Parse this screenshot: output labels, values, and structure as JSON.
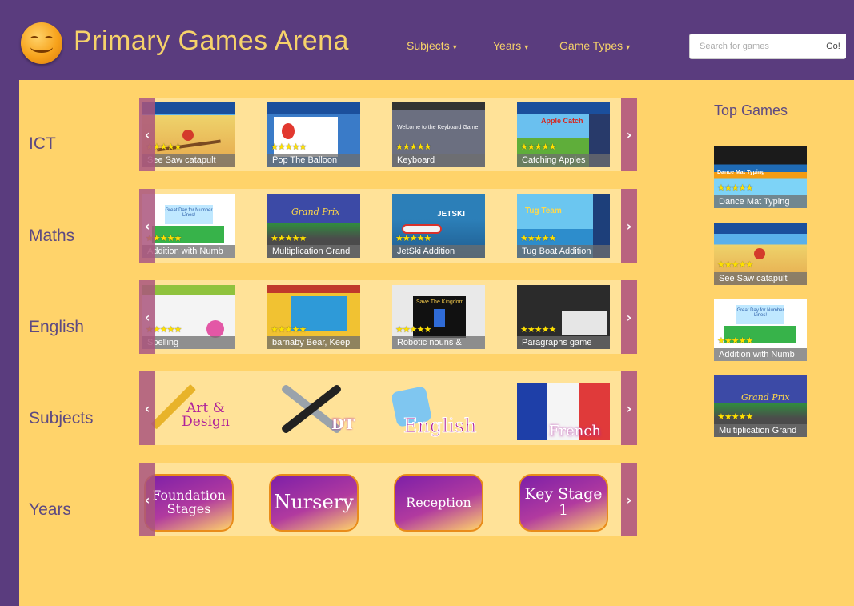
{
  "header": {
    "site_title": "Primary Games Arena",
    "nav": [
      {
        "label": "Subjects"
      },
      {
        "label": "Years"
      },
      {
        "label": "Game Types"
      }
    ],
    "search_placeholder": "Search for games",
    "search_button": "Go!"
  },
  "rows": [
    {
      "label": "ICT",
      "tiles": [
        {
          "caption": "See Saw catapult",
          "stars": "★★★★★"
        },
        {
          "caption": "Pop The Balloon",
          "stars": "★★★★★"
        },
        {
          "caption": "Keyboard",
          "stars": "★★★★★"
        },
        {
          "caption": "Catching Apples",
          "stars": "★★★★★"
        }
      ]
    },
    {
      "label": "Maths",
      "tiles": [
        {
          "caption": "Addition with Numb",
          "stars": "★★★★★"
        },
        {
          "caption": "Multiplication Grand",
          "stars": "★★★★★"
        },
        {
          "caption": "JetSki Addition",
          "stars": "★★★★★"
        },
        {
          "caption": "Tug Boat Addition",
          "stars": "★★★★★"
        }
      ]
    },
    {
      "label": "English",
      "tiles": [
        {
          "caption": "Spelling",
          "stars": "★★★★★"
        },
        {
          "caption": "barnaby Bear, Keep",
          "stars": "★★★★★"
        },
        {
          "caption": "Robotic nouns &",
          "stars": "★★★★★"
        },
        {
          "caption": "Paragraphs game",
          "stars": "★★★★★"
        }
      ]
    },
    {
      "label": "Subjects",
      "tiles": [
        {
          "caption": "Art & Design"
        },
        {
          "caption": "DT"
        },
        {
          "caption": "English"
        },
        {
          "caption": "French"
        }
      ]
    },
    {
      "label": "Years",
      "tiles": [
        {
          "caption": "Foundation Stages"
        },
        {
          "caption": "Nursery"
        },
        {
          "caption": "Reception"
        },
        {
          "caption": "Key Stage 1"
        }
      ]
    }
  ],
  "thumb_text": {
    "keyboard_heading": "Welcome to the Keyboard Game!",
    "numberline_heading": "Great Day for Number Lines!",
    "grand_prix": "Grand Prix",
    "jetski": "JETSKI",
    "tug_team": "Tug Team",
    "save_kingdom": "Save The Kingdom",
    "apple_catch": "Apple Catch",
    "dance_mat": "Dance Mat Typing"
  },
  "sidebar": {
    "title": "Top Games",
    "items": [
      {
        "caption": "Dance Mat Typing",
        "stars": "★★★★★"
      },
      {
        "caption": "See Saw catapult",
        "stars": "★★★★★"
      },
      {
        "caption": "Addition with Numb",
        "stars": "★★★★★"
      },
      {
        "caption": "Multiplication Grand",
        "stars": "★★★★★"
      }
    ]
  },
  "arrows": {
    "left": "‹",
    "right": "›"
  },
  "colors": {
    "header_bg": "#5a3c7e",
    "content_bg": "#ffd36a",
    "accent": "#f6d26a",
    "label": "#5e4a82"
  }
}
